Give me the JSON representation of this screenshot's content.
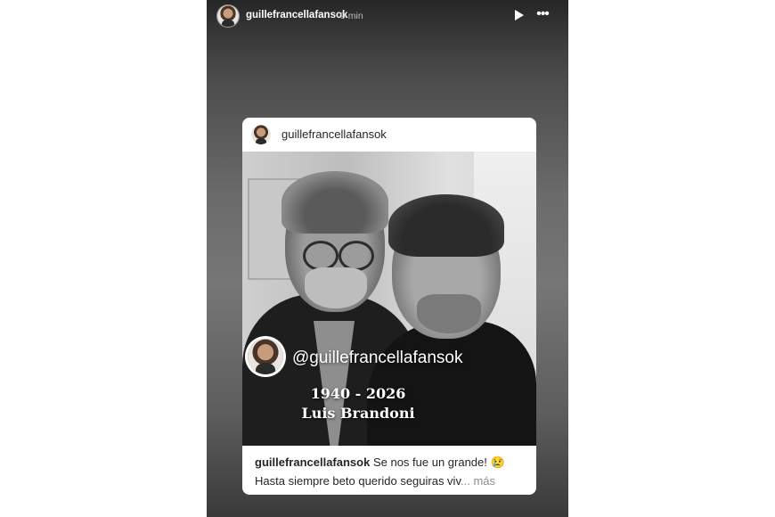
{
  "story": {
    "username": "guillefrancellafansok",
    "time": "9 min",
    "play_icon": "play-icon",
    "more_icon": "more-icon"
  },
  "post": {
    "username": "guillefrancellafansok",
    "overlay_handle": "@guillefrancellafansok",
    "years": "1940 - 2026",
    "name": "Luis Brandoni",
    "caption_user": "guillefrancellafansok",
    "caption_line1": "Se nos fue un grande! 😢",
    "caption_line2": "Hasta siempre beto querido seguiras viv",
    "more_label": "... más"
  }
}
